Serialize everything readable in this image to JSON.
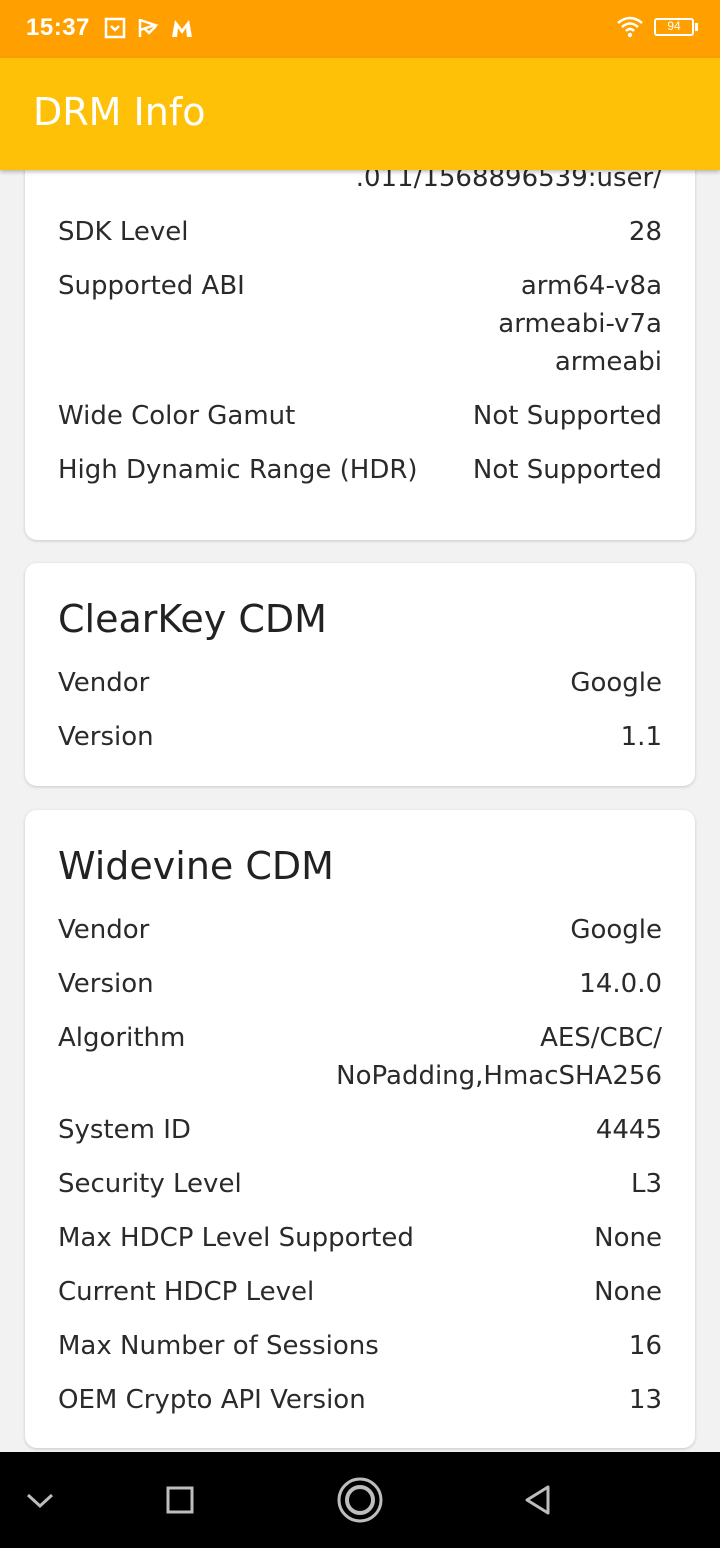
{
  "status_bar": {
    "time": "15:37",
    "battery": "94",
    "icons": [
      "notification-box-icon",
      "play-flag-icon",
      "malwarebytes-icon",
      "wifi-icon"
    ]
  },
  "app_bar": {
    "title": "DRM Info"
  },
  "system_card": {
    "partial_line_top": "...",
    "partial_line": ".011/1568896539:user/",
    "rows": [
      {
        "label": "SDK Level",
        "value": "28"
      },
      {
        "label": "Supported ABI",
        "value": "arm64-v8a\narmeabi-v7a\narmeabi"
      },
      {
        "label": "Wide Color Gamut",
        "value": "Not Supported"
      },
      {
        "label": "High Dynamic Range (HDR)",
        "value": "Not Supported"
      }
    ]
  },
  "clearkey_card": {
    "title": "ClearKey CDM",
    "rows": [
      {
        "label": "Vendor",
        "value": "Google"
      },
      {
        "label": "Version",
        "value": "1.1"
      }
    ]
  },
  "widevine_card": {
    "title": "Widevine CDM",
    "rows": [
      {
        "label": "Vendor",
        "value": "Google"
      },
      {
        "label": "Version",
        "value": "14.0.0"
      },
      {
        "label": "Algorithm",
        "value": "AES/CBC/\nNoPadding,HmacSHA256"
      },
      {
        "label": "System ID",
        "value": "4445"
      },
      {
        "label": "Security Level",
        "value": "L3"
      },
      {
        "label": "Max HDCP Level Supported",
        "value": "None"
      },
      {
        "label": "Current HDCP Level",
        "value": "None"
      },
      {
        "label": "Max Number of Sessions",
        "value": "16"
      },
      {
        "label": "OEM Crypto API Version",
        "value": "13"
      }
    ]
  },
  "nav_bar": {
    "buttons": [
      "chevron-down-icon",
      "recents-square-icon",
      "home-circle-icon",
      "back-triangle-icon"
    ]
  }
}
